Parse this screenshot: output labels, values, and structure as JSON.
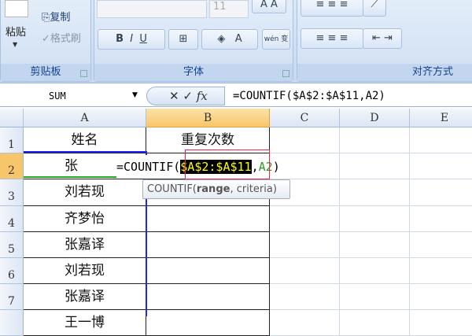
{
  "ribbon": {
    "clipboard": {
      "label": "剪贴板",
      "paste": "粘贴",
      "copy": "复制",
      "format_painter": "格式刷"
    },
    "font": {
      "label": "字体",
      "size": "11",
      "bold": "B",
      "italic": "I",
      "underline": "U",
      "font_color": "A",
      "phonetic": "wén 变"
    },
    "alignment": {
      "label": "对齐方式"
    }
  },
  "formula_bar": {
    "name_box": "SUM",
    "cancel": "✕",
    "enter": "✓",
    "fx": "fx",
    "formula": "=COUNTIF($A$2:$A$11,A2)"
  },
  "columns": [
    "A",
    "B",
    "C",
    "D",
    "E"
  ],
  "rows": [
    "1",
    "2",
    "3",
    "4",
    "5",
    "6",
    "7"
  ],
  "cells": {
    "A": [
      "姓名",
      "张",
      "刘若现",
      "齐梦怡",
      "张嘉译",
      "刘若现",
      "张嘉译",
      "王一博"
    ],
    "B1": "重复次数"
  },
  "edit": {
    "prefix": "=COUNTIF(",
    "range": "$A$2:$A$11",
    ",": ",",
    "crit": "A2",
    ")": ")"
  },
  "tooltip": {
    "fn": "COUNTIF(",
    "arg1": "range",
    ", criteria)": ", criteria)"
  }
}
